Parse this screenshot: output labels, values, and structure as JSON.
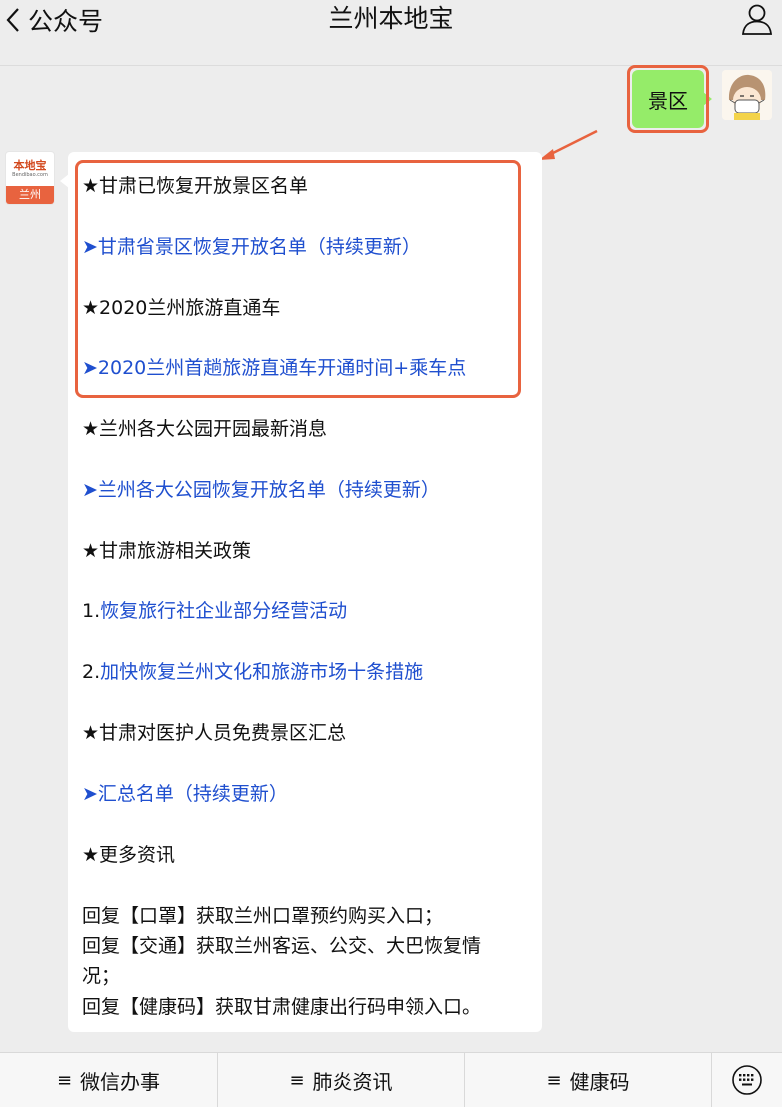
{
  "nav": {
    "back_label": "公众号",
    "title": "兰州本地宝"
  },
  "outgoing": {
    "text": "景区"
  },
  "account_avatar": {
    "logo_text": "本地宝",
    "logo_sub": "Bendibao.com",
    "city": "兰州"
  },
  "message": {
    "lines": [
      "★甘肃已恢复开放景区名单",
      "➤甘肃省景区恢复开放名单（持续更新）",
      "★2020兰州旅游直通车",
      "➤2020兰州首趟旅游直通车开通时间+乘车点",
      "★兰州各大公园开园最新消息",
      "➤兰州各大公园恢复开放名单（持续更新）",
      "★甘肃旅游相关政策",
      "恢复旅行社企业部分经营活动",
      "加快恢复兰州文化和旅游市场十条措施",
      "★甘肃对医护人员免费景区汇总",
      "➤汇总名单（持续更新）",
      "★更多资讯",
      "回复【口罩】获取兰州口罩预约购买入口；",
      "回复【交通】获取兰州客运、公交、大巴恢复情",
      "况；",
      "回复【健康码】获取甘肃健康出行码申领入口。"
    ],
    "list_nums": [
      "1.",
      "2."
    ]
  },
  "menu": {
    "items": [
      "微信办事",
      "肺炎资讯",
      "健康码"
    ]
  },
  "colors": {
    "highlight": "#e8633f",
    "link": "#1f4fcf",
    "bubble_out": "#95ec69"
  }
}
